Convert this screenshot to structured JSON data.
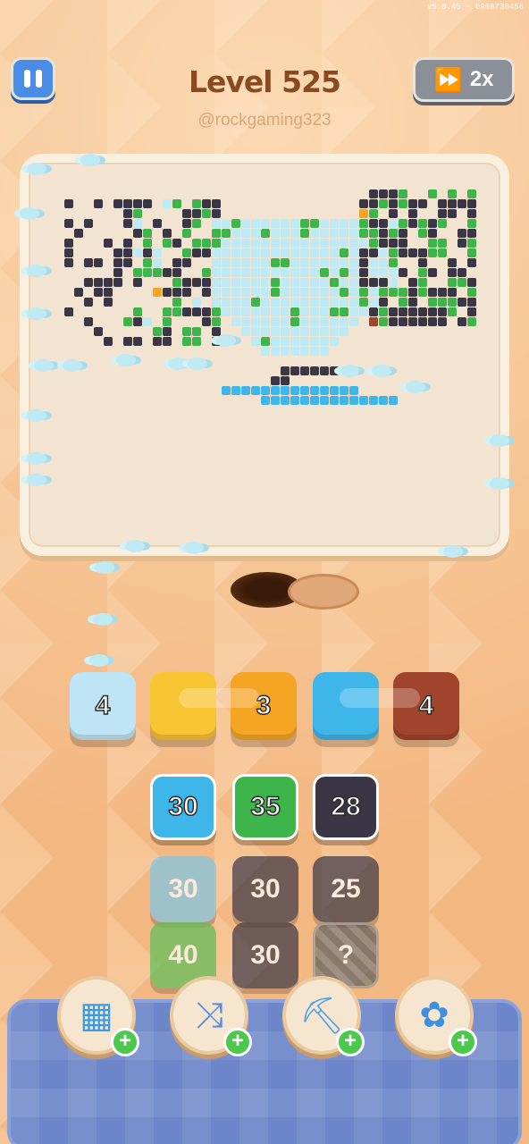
{
  "header": {
    "version": "v5.0.45 - 6908736456",
    "level_title": "Level 525",
    "username": "@rockgaming323",
    "speed_label": "2x",
    "pause_icon": "pause-icon",
    "speed_icon": "fast-forward-icon"
  },
  "queue_slots": [
    {
      "value": "4",
      "color": "#bfe4f5"
    },
    {
      "value": "",
      "color": "#f7c531"
    },
    {
      "value": "3",
      "color": "#f5a524"
    },
    {
      "value": "",
      "color": "#3fb6ea"
    },
    {
      "value": "4",
      "color": "#a0452b"
    }
  ],
  "tiles": [
    {
      "value": "30",
      "color": "#3fb6ea",
      "active": true
    },
    {
      "value": "35",
      "color": "#3db54a",
      "active": true
    },
    {
      "value": "28",
      "color": "#3a3645",
      "active": true
    },
    {
      "value": "30",
      "color": "#7cc8ea",
      "active": false
    },
    {
      "value": "30",
      "color": "#3a3645",
      "active": false
    },
    {
      "value": "25",
      "color": "#3a3645",
      "active": false
    },
    {
      "value": "40",
      "color": "#5cbf5a",
      "active": false
    },
    {
      "value": "30",
      "color": "#3a3645",
      "active": false
    },
    {
      "value": "?",
      "color": "#6b6b6b",
      "active": false
    }
  ],
  "boosters": [
    {
      "icon": "add-slot-icon"
    },
    {
      "icon": "shuffle-icon"
    },
    {
      "icon": "magnet-claw-icon"
    },
    {
      "icon": "flower-bomb-icon"
    }
  ],
  "colors": {
    "dark": "#3a3645",
    "green": "#3db54a",
    "light_blue": "#bfe9f3",
    "blue": "#3fb6ea",
    "orange": "#f5a524",
    "brown": "#a0452b"
  }
}
